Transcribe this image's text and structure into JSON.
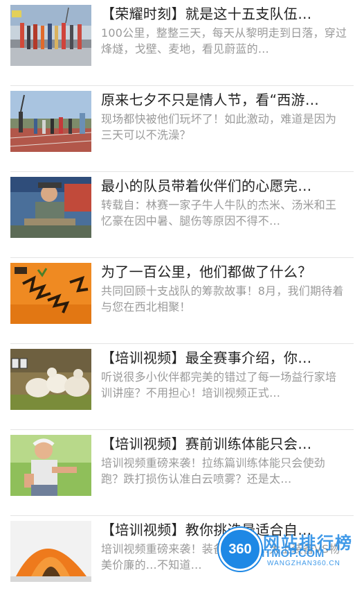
{
  "articles": [
    {
      "title": "【荣耀时刻】就是这十五支队伍…",
      "desc": "100公里，整整三天，每天从黎明走到日落，穿过烽燧，戈壁、麦地，看见蔚蓝的…",
      "thumb": "team-flags-photo"
    },
    {
      "title": "原来七夕不只是情人节，看“西游…",
      "desc": "现场都快被他们玩坏了！如此激动，难道是因为三天可以不洗澡？",
      "thumb": "runners-track-photo"
    },
    {
      "title": "最小的队员带着伙伴们的心愿完…",
      "desc": "转载自：林赛一家子牛人牛队的杰米、汤米和王忆豪在因中暑、腿伤等原因不得不…",
      "thumb": "child-tent-photo"
    },
    {
      "title": "为了一百公里，他们都做了什么？",
      "desc": "共同回顾十支战队的筹款故事！8月，我们期待着与您在西北相聚！",
      "thumb": "calligraphy-poster"
    },
    {
      "title": "【培训视频】最全赛事介绍，你…",
      "desc": "听说很多小伙伴都完美的错过了每一场益行家培训讲座？不用担心！培训视频正式…",
      "thumb": "sheep-video-still"
    },
    {
      "title": "【培训视频】赛前训练体能只会…",
      "desc": "培训视频重磅来袭！拉练篇训练体能只会使劲跑？跌打损伤认准白云喷雾？还是太…",
      "thumb": "woman-running-photo"
    },
    {
      "title": "【培训视频】教你挑选最适合自…",
      "desc": "培训视频重磅来袭！装备篇挑狂…大上装备VS物美价廉的…不知道…",
      "thumb": "orange-tent-photo"
    }
  ],
  "watermark": {
    "badge": "360",
    "cn": "网站排行榜",
    "domain": "ITMOP.COM",
    "sub": "WANGZHAN360.CN"
  }
}
